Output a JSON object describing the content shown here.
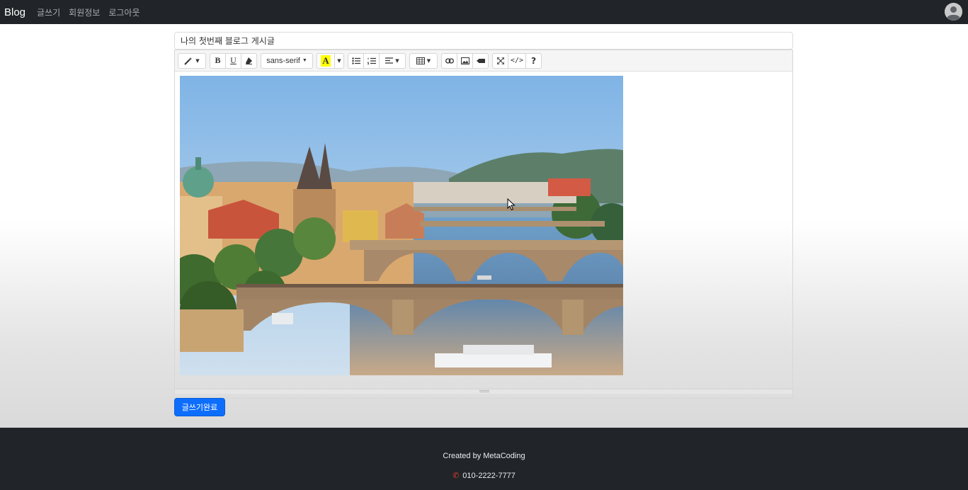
{
  "navbar": {
    "brand": "Blog",
    "links": [
      "글쓰기",
      "회원정보",
      "로그아웃"
    ],
    "avatar_icon": "user-avatar-icon"
  },
  "post": {
    "title_value": "나의 첫번째 블로그 게시글"
  },
  "toolbar": {
    "font_name": "sans-serif",
    "bold_label": "B",
    "underline_label": "U",
    "color_label": "A",
    "help_label": "?",
    "code_label": "</>",
    "highlight_color": "#ffff00"
  },
  "actions": {
    "submit_label": "글쓰기완료"
  },
  "footer": {
    "credit": "Created by MetaCoding",
    "phone": "010-2222-7777"
  },
  "colors": {
    "navbar_bg": "#212529",
    "primary": "#0d6efd",
    "phone_icon": "#e03b2b"
  }
}
